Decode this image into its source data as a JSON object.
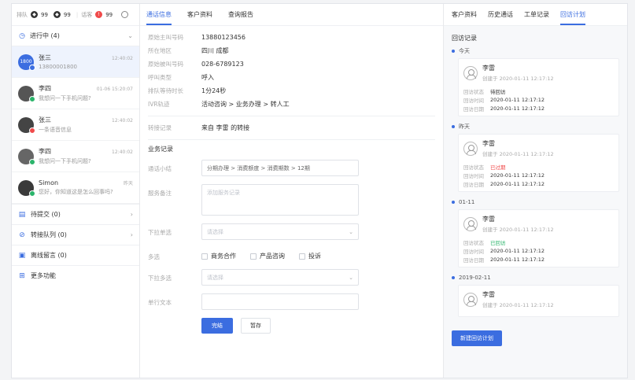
{
  "status_bar": {
    "queue_label": "排队",
    "queue_a": "99",
    "queue_b": "99",
    "talk_label": "话客",
    "talk_count": "99"
  },
  "left": {
    "in_progress": "进行中 (4)",
    "sessions": [
      {
        "name": "张三",
        "time": "12:40:02",
        "msg": "13800001800",
        "avatar": "1800"
      },
      {
        "name": "李四",
        "time": "01-06 15:20:07",
        "msg": "我想问一下手机问题?"
      },
      {
        "name": "张三",
        "time": "12:40:02",
        "msg": "一条语音信息"
      },
      {
        "name": "李四",
        "time": "12:40:02",
        "msg": "我想问一下手机问题?"
      },
      {
        "name": "Simon",
        "time": "昨天",
        "msg": "您好，你知道这是怎么回事吗?"
      }
    ],
    "menu": [
      {
        "label": "待提交 (0)"
      },
      {
        "label": "转接队列 (0)"
      },
      {
        "label": "离线留言 (0)"
      },
      {
        "label": "更多功能"
      }
    ]
  },
  "mid": {
    "tabs": [
      "通话信息",
      "客户资料",
      "查询报告"
    ],
    "info": [
      {
        "label": "原始主叫号码",
        "value": "13880123456"
      },
      {
        "label": "所在地区",
        "value": "四川 成都"
      },
      {
        "label": "原始被叫号码",
        "value": "028-6789123"
      },
      {
        "label": "呼叫类型",
        "value": "呼入"
      },
      {
        "label": "排队等待时长",
        "value": "1分24秒"
      },
      {
        "label": "IVR轨迹",
        "value": "活动咨询 > 业务办理 > 转人工"
      }
    ],
    "transfer": {
      "label": "转接记录",
      "value": "来自 李雷 的转接"
    },
    "section": "业务记录",
    "form": {
      "summary_label": "通话小结",
      "summary_value": "分期办理 > 消费额度 > 消费期数 > 12期",
      "remark_label": "服务备注",
      "remark_placeholder": "添加服务记录",
      "dropdown_label": "下拉单选",
      "dropdown_placeholder": "请选择",
      "multi_label": "多选",
      "checks": [
        "商务合作",
        "产品咨询",
        "投诉"
      ],
      "multi_dropdown_label": "下拉多选",
      "multi_dropdown_placeholder": "请选择",
      "text_label": "单行文本",
      "submit": "完结",
      "draft": "暂存"
    }
  },
  "right": {
    "tabs": [
      "客户资料",
      "历史通话",
      "工单记录",
      "回访计划"
    ],
    "title": "回访记录",
    "groups": [
      {
        "date": "今天",
        "name": "李雷",
        "created": "创建于 2020-01-11 12:17:12",
        "status_k": "回访状态",
        "status_v": "待回访",
        "status_color": "normal",
        "time_k": "回访时间",
        "time_v": "2020-01-11 12:17:12",
        "date_k": "回访日期",
        "date_v": "2020-01-11 12:17:12"
      },
      {
        "date": "昨天",
        "name": "李雷",
        "created": "创建于 2020-01-11 12:17:12",
        "status_k": "回访状态",
        "status_v": "已过期",
        "status_color": "red",
        "time_k": "回访时间",
        "time_v": "2020-01-11 12:17:12",
        "date_k": "回访日期",
        "date_v": "2020-01-11 12:17:12"
      },
      {
        "date": "01-11",
        "name": "李雷",
        "created": "创建于 2020-01-11 12:17:12",
        "status_k": "回访状态",
        "status_v": "已回访",
        "status_color": "green",
        "time_k": "回访时间",
        "time_v": "2020-01-11 12:17:12",
        "date_k": "回访日期",
        "date_v": "2020-01-11 12:17:12"
      },
      {
        "date": "2019-02-11",
        "name": "李雷",
        "created": "创建于 2020-01-11 12:17:12"
      }
    ],
    "new_button": "新建回访计划"
  },
  "colors": {
    "accent": "#3b6de0",
    "danger": "#f04b4b",
    "success": "#2bb46b"
  }
}
